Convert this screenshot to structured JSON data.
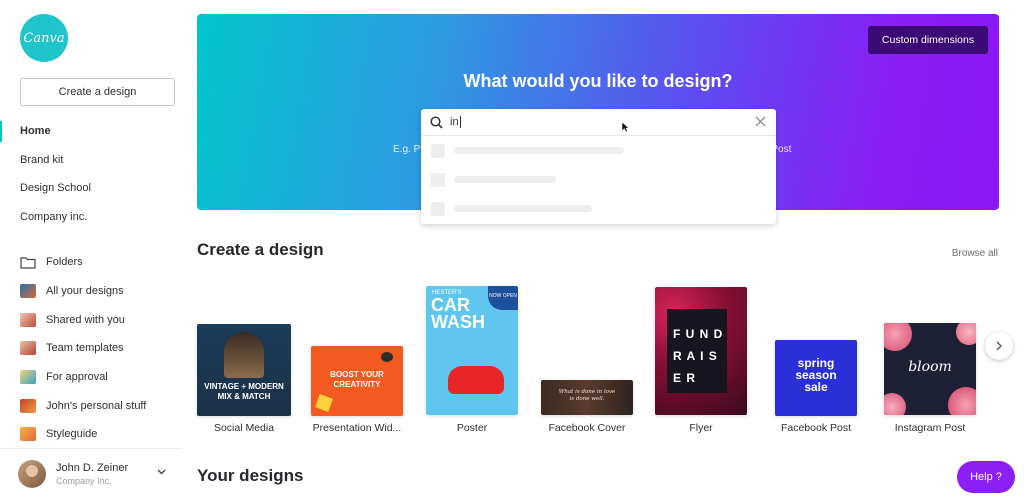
{
  "app": {
    "logo_text": "Canva",
    "brand_color": "#00c4cc"
  },
  "sidebar": {
    "create_label": "Create a design",
    "nav_top": [
      {
        "label": "Home",
        "active": true
      },
      {
        "label": "Brand kit"
      },
      {
        "label": "Design School"
      },
      {
        "label": "Company inc."
      }
    ],
    "nav_bottom": [
      {
        "label": "Folders",
        "icon": "folder-icon"
      },
      {
        "label": "All your designs",
        "icon": "thumbnail"
      },
      {
        "label": "Shared with you",
        "icon": "thumbnail"
      },
      {
        "label": "Team templates",
        "icon": "thumbnail"
      },
      {
        "label": "For approval",
        "icon": "thumbnail"
      },
      {
        "label": "John's personal stuff",
        "icon": "thumbnail"
      },
      {
        "label": "Styleguide",
        "icon": "thumbnail"
      }
    ],
    "user": {
      "name": "John D. Zeiner",
      "company": "Company Inc."
    }
  },
  "hero": {
    "custom_label": "Custom dimensions",
    "title": "What would you like to design?",
    "hint_left": "E.g. P",
    "hint_right": "n Post"
  },
  "search": {
    "value": "in",
    "clear_icon": "close-icon",
    "search_icon": "search-icon"
  },
  "create_section": {
    "title": "Create a design",
    "browse_all": "Browse all",
    "cards": [
      {
        "label": "Social Media",
        "art_lines": [
          "VINTAGE + MODERN",
          "MIX & MATCH"
        ]
      },
      {
        "label": "Presentation Wid...",
        "art_lines": [
          "BOOST YOUR",
          "CREATIVITY"
        ]
      },
      {
        "label": "Poster",
        "art_lines": [
          "HESTER'S",
          "CAR",
          "WASH",
          "NOW OPEN"
        ]
      },
      {
        "label": "Facebook Cover",
        "art_lines": [
          "What is done in love",
          "is done well."
        ]
      },
      {
        "label": "Flyer",
        "art_lines": [
          "F U N D",
          "R A I S",
          "E R"
        ]
      },
      {
        "label": "Facebook Post",
        "art_lines": [
          "spring",
          "season",
          "sale"
        ]
      },
      {
        "label": "Instagram Post",
        "art_lines": [
          "bloom"
        ]
      }
    ]
  },
  "your_designs": {
    "title": "Your designs"
  },
  "help": {
    "label": "Help ?"
  }
}
